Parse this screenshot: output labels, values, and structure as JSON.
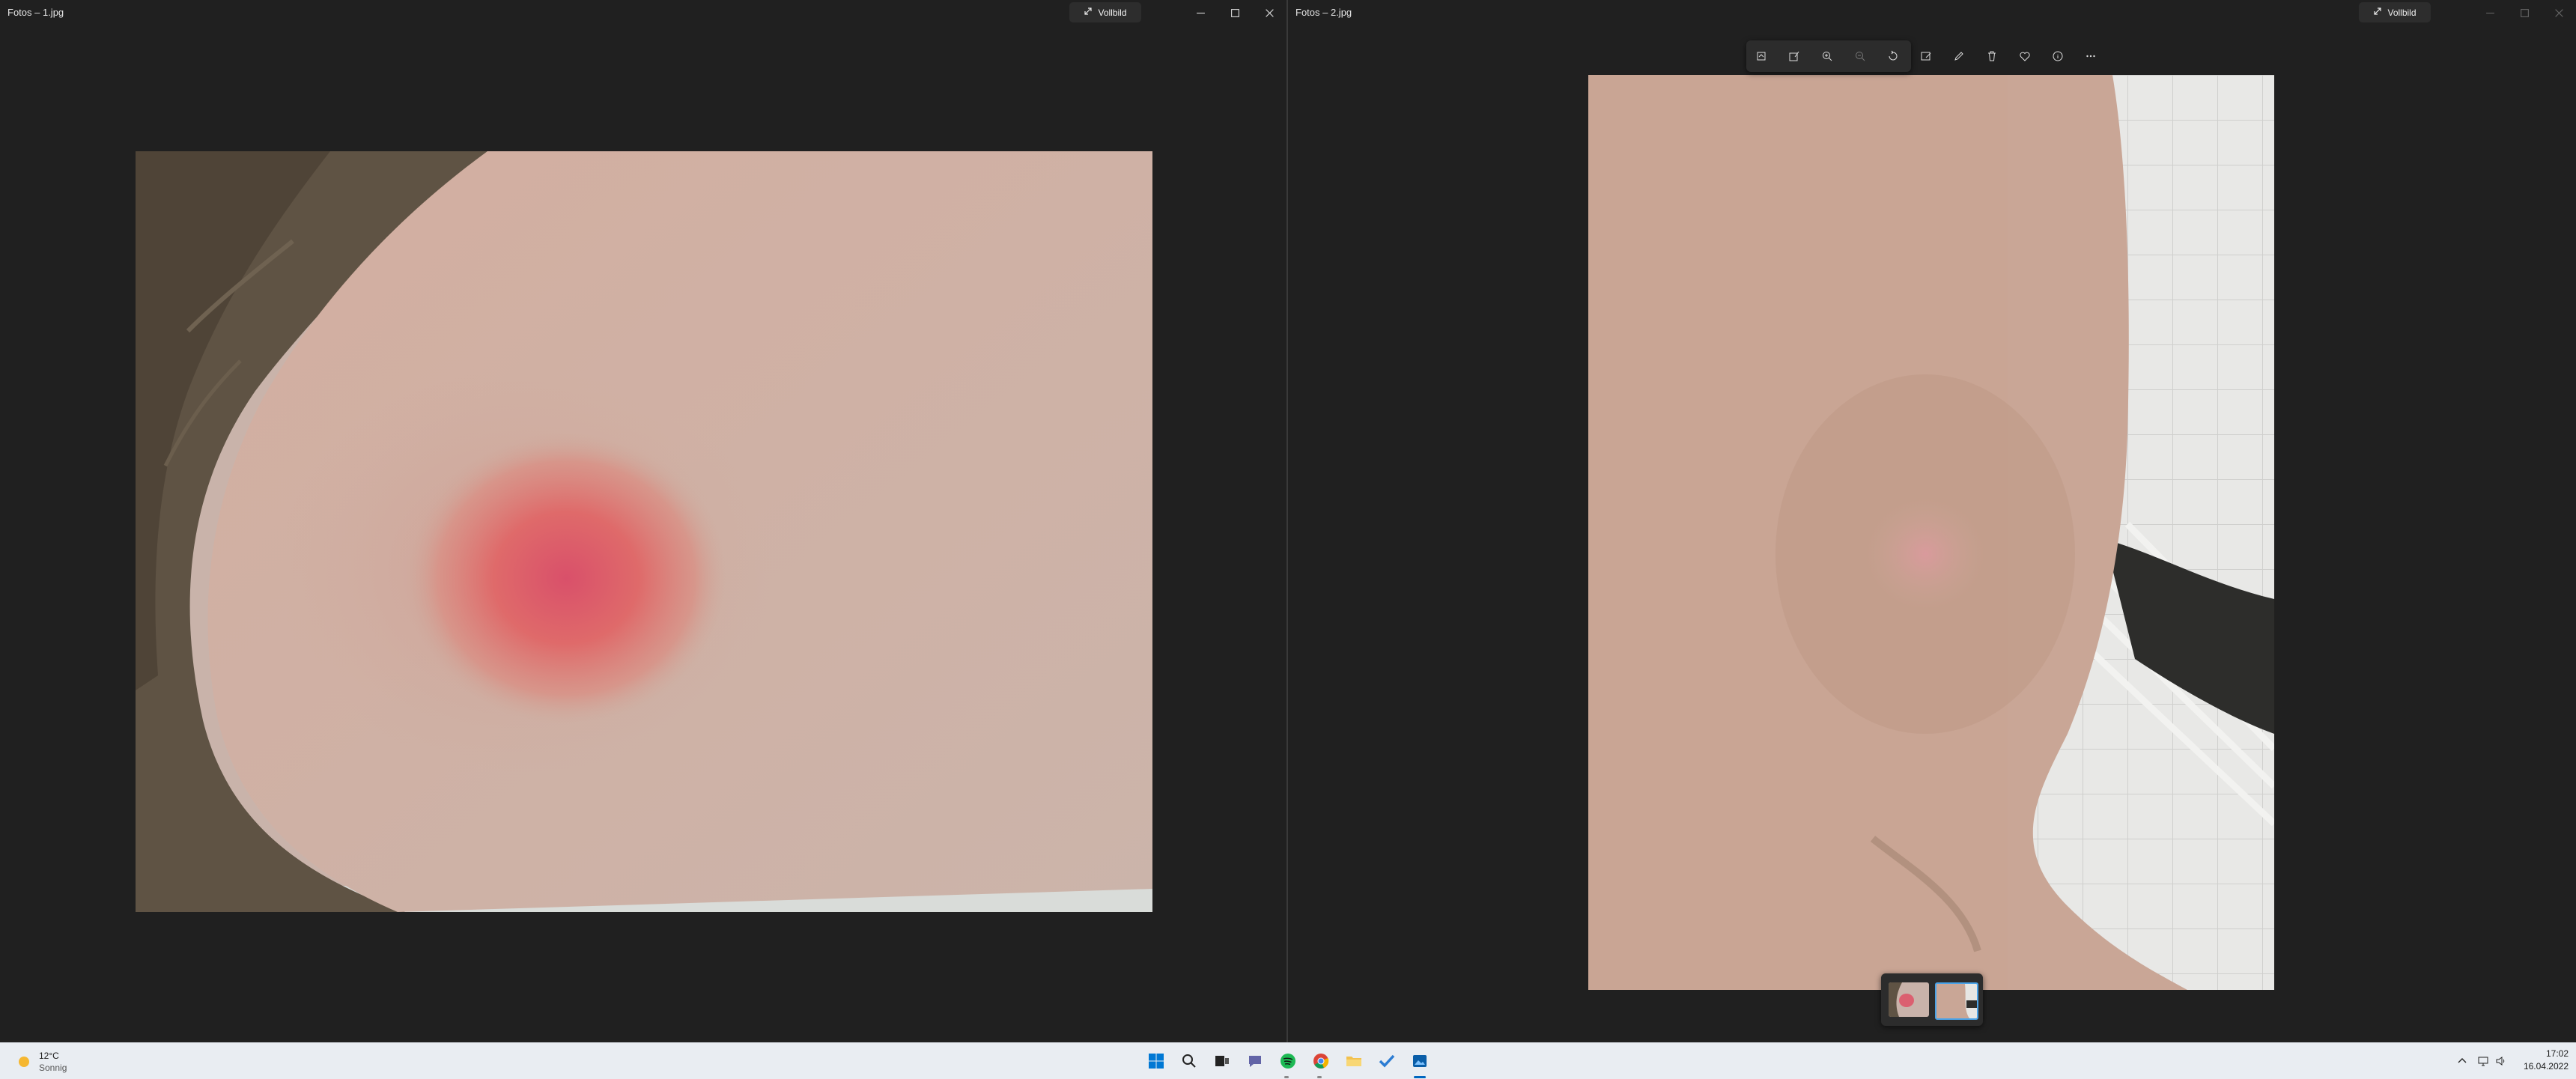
{
  "window_left": {
    "title": "Fotos – 1.jpg",
    "fullscreen_label": "Vollbild",
    "icons": [
      "fullscreen-icon",
      "minimize-icon",
      "maximize-icon",
      "close-icon"
    ]
  },
  "window_right": {
    "title": "Fotos – 2.jpg",
    "fullscreen_label": "Vollbild",
    "toolbar_icons": [
      "crop-icon",
      "edit-image-icon",
      "zoom-in-icon",
      "zoom-out-icon",
      "rotate-icon",
      "effects-icon",
      "draw-icon",
      "delete-icon",
      "favorite-icon",
      "info-icon",
      "more-icon"
    ],
    "filmstrip": [
      "thumbnail-1",
      "thumbnail-2"
    ],
    "selected_thumbnail": 2
  },
  "taskbar": {
    "weather_temp": "12°C",
    "weather_text": "Sonnig",
    "apps": [
      "windows-start-icon",
      "search-icon",
      "task-view-icon",
      "chat-icon",
      "spotify-icon",
      "chrome-icon",
      "file-explorer-icon",
      "todo-icon",
      "photos-icon"
    ],
    "time": "17:02",
    "date": "16.04.2022"
  },
  "colors": {
    "window_bg": "#202020",
    "taskbar_bg": "#e9edf2",
    "accent": "#0067c0"
  }
}
